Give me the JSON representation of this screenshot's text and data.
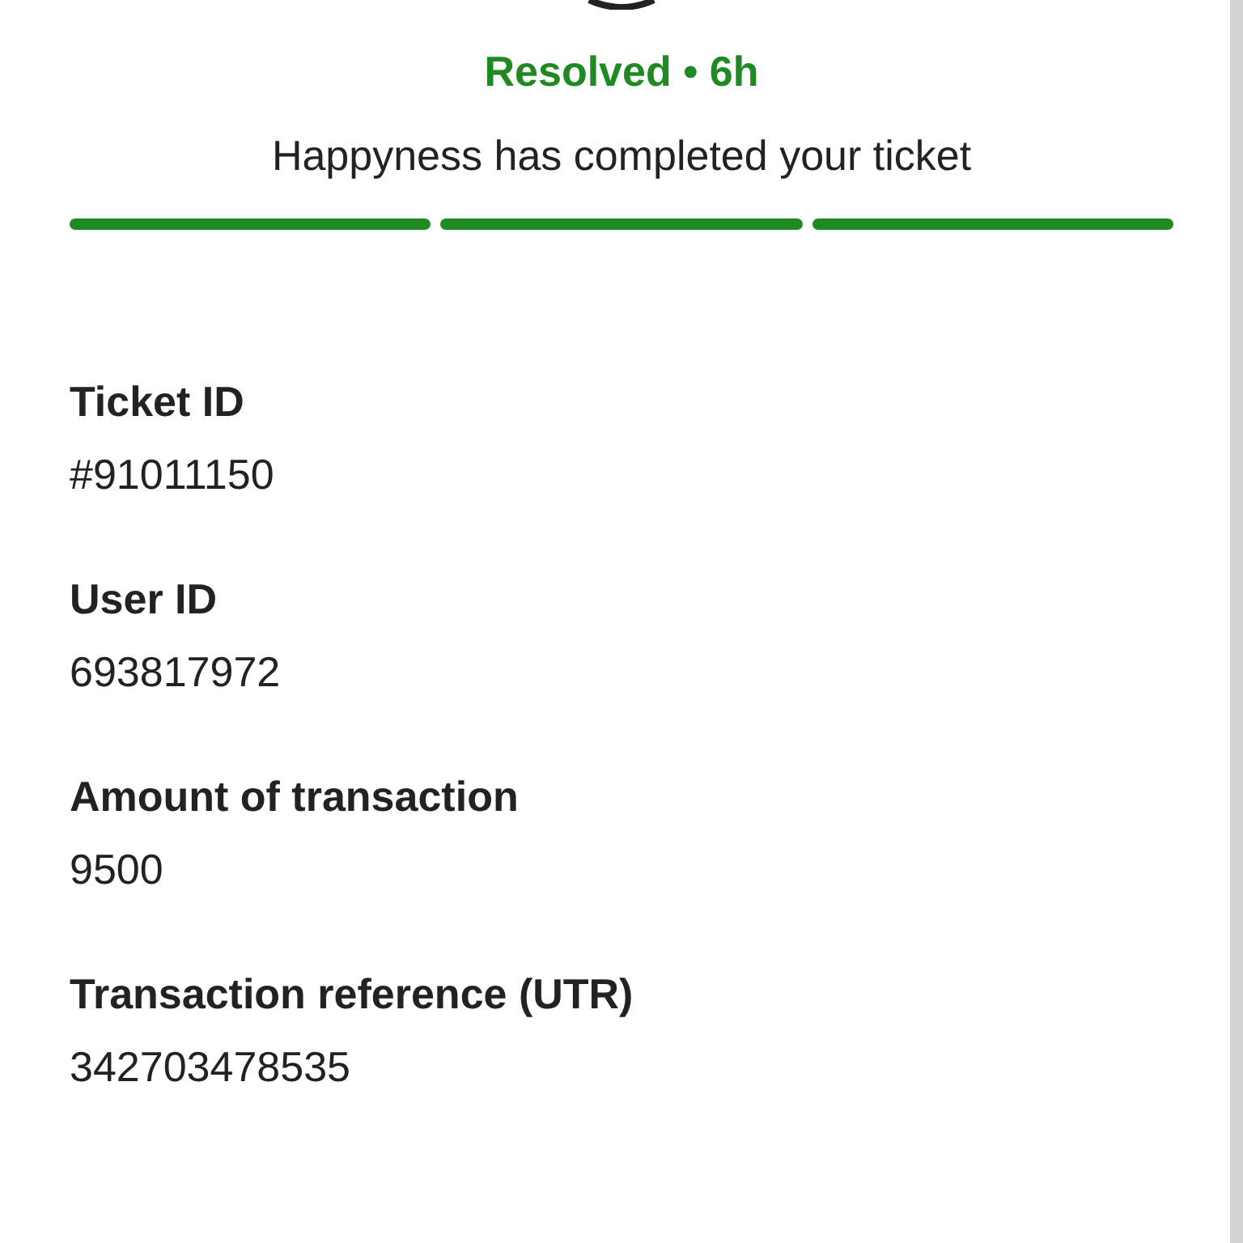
{
  "status": {
    "label": "Resolved • 6h",
    "message": "Happyness has completed your ticket"
  },
  "progress": [
    {
      "complete": true
    },
    {
      "complete": true
    },
    {
      "complete": true
    }
  ],
  "fields": [
    {
      "label": "Ticket ID",
      "value": "#91011150"
    },
    {
      "label": "User ID",
      "value": "693817972"
    },
    {
      "label": "Amount of transaction",
      "value": "9500"
    },
    {
      "label": "Transaction reference (UTR)",
      "value": "342703478535"
    }
  ]
}
